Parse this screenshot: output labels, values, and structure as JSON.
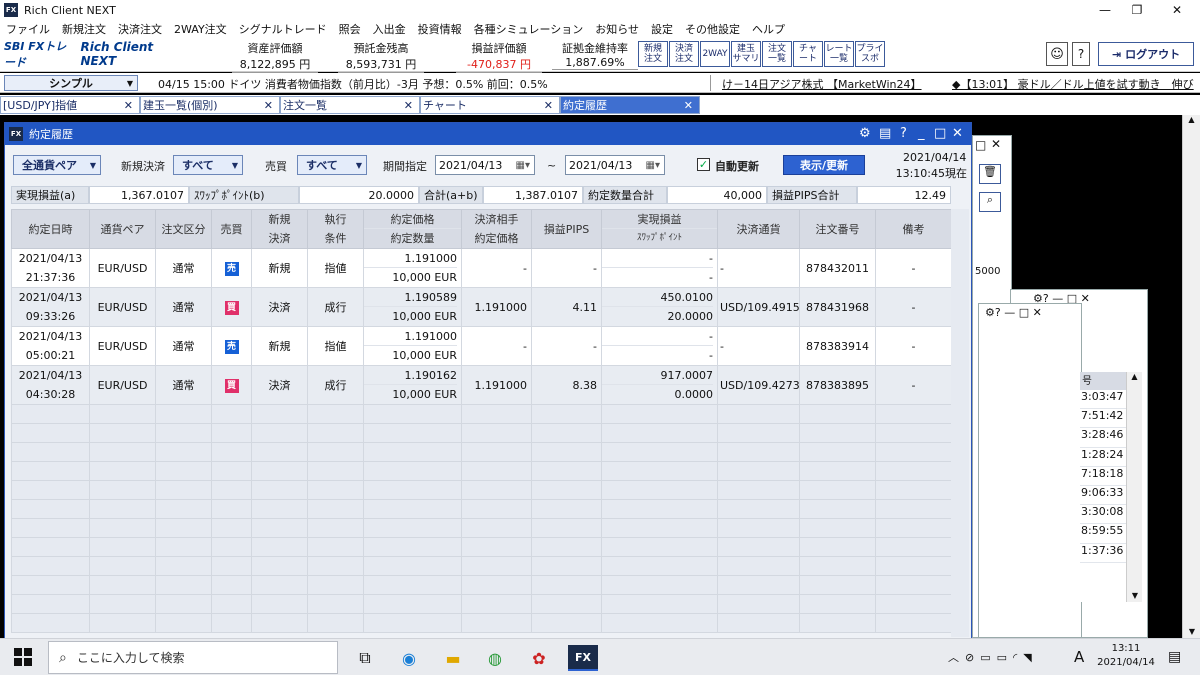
{
  "titlebar": {
    "app_icon": "FX",
    "title": "Rich Client NEXT",
    "minimize": "—",
    "maximize": "❐",
    "close": "✕"
  },
  "menu": [
    "ファイル",
    "新規注文",
    "決済注文",
    "2WAY注文",
    "シグナルトレード",
    "照会",
    "入出金",
    "投資情報",
    "各種シミュレーション",
    "お知らせ",
    "設定",
    "その他設定",
    "ヘルプ"
  ],
  "logo": {
    "brand": "SBI FXトレード",
    "product": "Rich Client NEXT"
  },
  "metrics": [
    {
      "label": "資産評価額",
      "value": "8,122,895 円",
      "color": "#111111"
    },
    {
      "label": "預託金残高",
      "value": "8,593,731 円",
      "color": "#111111"
    },
    {
      "label": "損益評価額",
      "value": "-470,837 円",
      "color": "#e0201a"
    },
    {
      "label": "証拠金維持率",
      "value": "1,887.69%",
      "color": "#111111"
    }
  ],
  "toolbar_buttons": [
    "新規\n注文",
    "決済\n注文",
    "2WAY",
    "建玉\nサマリ",
    "注文\n一覧",
    "チャ\nート",
    "レート\n一覧",
    "プライ\nスボ"
  ],
  "logout": "ログアウト",
  "view_select": "シンプル",
  "ticker": {
    "left": "04/15 15:00 ドイツ 消費者物価指数（前月比）-3月 予想：0.5% 前回：0.5%",
    "middle": "け－14日アジア株式 【MarketWin24】",
    "right": "◆【13:01】 豪ドル／ドル上値を試す動き　伸び"
  },
  "tabs": [
    {
      "label": "[USD/JPY]指値",
      "active": false
    },
    {
      "label": "建玉一覧(個別)",
      "active": false
    },
    {
      "label": "注文一覧",
      "active": false
    },
    {
      "label": "チャート",
      "active": false
    },
    {
      "label": "約定履歴",
      "active": true
    }
  ],
  "window": {
    "title": "約定履歴",
    "filters": {
      "pair": "全通貨ペア",
      "new_settle_label": "新規決済",
      "new_settle_value": "すべて",
      "buysell_label": "売買",
      "buysell_value": "すべて",
      "period_label": "期間指定",
      "date_from": "2021/04/13",
      "tilde": "~",
      "date_to": "2021/04/13",
      "auto_update": "自動更新",
      "show_button": "表示/更新",
      "as_of_date": "2021/04/14",
      "as_of_time": "13:10:45現在"
    },
    "summary": [
      {
        "label": "実現損益(a)",
        "value": "1,367.0107"
      },
      {
        "label": "ｽﾜｯﾌﾟﾎﾟｲﾝﾄ(b)",
        "value": "20.0000"
      },
      {
        "label": "合計(a+b)",
        "value": "1,387.0107"
      },
      {
        "label": "約定数量合計",
        "value": "40,000"
      },
      {
        "label": "損益PIPS合計",
        "value": "12.49"
      }
    ],
    "columns": {
      "date": "約定日時",
      "pair": "通貨ペア",
      "order_type": "注文区分",
      "side": "売買",
      "new_settle": [
        "新規",
        "決済"
      ],
      "exec_cond": [
        "執行",
        "条件"
      ],
      "price_qty": [
        "約定価格",
        "約定数量"
      ],
      "counter_price": [
        "決済相手",
        "約定価格"
      ],
      "pips": "損益PIPS",
      "realized": [
        "実現損益",
        "ｽﾜｯﾌﾟﾎﾟｲﾝﾄ"
      ],
      "settle_ccy": "決済通貨",
      "order_no": "注文番号",
      "note": "備考"
    },
    "rows": [
      {
        "date": "2021/04/13",
        "time": "21:37:36",
        "pair": "EUR/USD",
        "order_type": "通常",
        "side": "売",
        "side_kind": "sell",
        "new_settle": "新規",
        "exec": "指値",
        "price": "1.191000",
        "qty": "10,000 EUR",
        "counter": "-",
        "pips": "-",
        "pnl": "-",
        "swap": "-",
        "ccy": "-",
        "order_no": "878432011",
        "note": "-"
      },
      {
        "date": "2021/04/13",
        "time": "09:33:26",
        "pair": "EUR/USD",
        "order_type": "通常",
        "side": "買",
        "side_kind": "buy",
        "new_settle": "決済",
        "exec": "成行",
        "price": "1.190589",
        "qty": "10,000 EUR",
        "counter": "1.191000",
        "pips": "4.11",
        "pnl": "450.0100",
        "swap": "20.0000",
        "ccy": "USD/109.4915",
        "order_no": "878431968",
        "note": "-"
      },
      {
        "date": "2021/04/13",
        "time": "05:00:21",
        "pair": "EUR/USD",
        "order_type": "通常",
        "side": "売",
        "side_kind": "sell",
        "new_settle": "新規",
        "exec": "指値",
        "price": "1.191000",
        "qty": "10,000 EUR",
        "counter": "-",
        "pips": "-",
        "pnl": "-",
        "swap": "-",
        "ccy": "-",
        "order_no": "878383914",
        "note": "-"
      },
      {
        "date": "2021/04/13",
        "time": "04:30:28",
        "pair": "EUR/USD",
        "order_type": "通常",
        "side": "買",
        "side_kind": "buy",
        "new_settle": "決済",
        "exec": "成行",
        "price": "1.190162",
        "qty": "10,000 EUR",
        "counter": "1.191000",
        "pips": "8.38",
        "pnl": "917.0007",
        "swap": "0.0000",
        "ccy": "USD/109.4273",
        "order_no": "878383895",
        "note": "-"
      }
    ]
  },
  "bg_window": {
    "value": "5000",
    "times": [
      "3:03:47",
      "7:51:42",
      "3:28:46",
      "1:28:24",
      "7:18:18",
      "9:06:33",
      "3:30:08",
      "8:59:55",
      "1:37:36"
    ],
    "partial_header": "号"
  },
  "taskbar": {
    "search_placeholder": "ここに入力して検索",
    "time": "13:11",
    "date": "2021/04/14",
    "ime": "A"
  }
}
